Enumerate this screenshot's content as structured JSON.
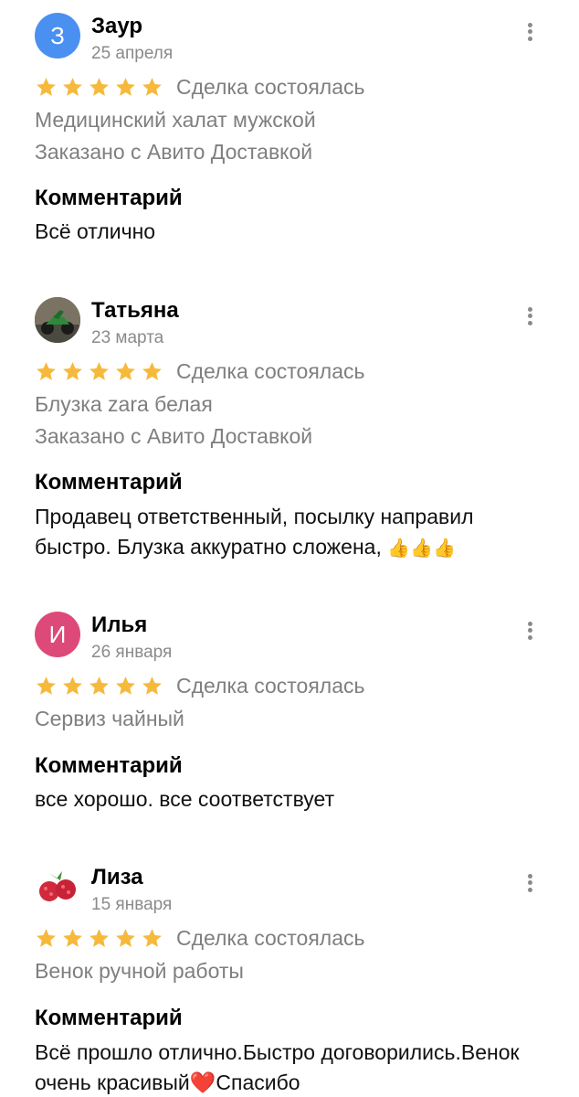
{
  "reviews": [
    {
      "author": "Заур",
      "avatar_letter": "З",
      "avatar_color": "#4a90f0",
      "date": "25 апреля",
      "deal_status": "Сделка состоялась",
      "rating": 5,
      "item": "Медицинский халат мужской",
      "delivery": "Заказано с Авито Доставкой",
      "comment_heading": "Комментарий",
      "comment": "Всё отлично"
    },
    {
      "author": "Татьяна",
      "avatar_image": "motorcycle-photo",
      "date": "23 марта",
      "deal_status": "Сделка состоялась",
      "rating": 5,
      "item": "Блузка zara белая",
      "delivery": "Заказано с Авито Доставкой",
      "comment_heading": "Комментарий",
      "comment": "Продавец ответственный, посылку направил быстро. Блузка аккуратно сложена,",
      "comment_emoji": "👍👍👍"
    },
    {
      "author": "Илья",
      "avatar_letter": "И",
      "avatar_color": "#dd4a7a",
      "date": "26 января",
      "deal_status": "Сделка состоялась",
      "rating": 5,
      "item": "Сервиз чайный",
      "comment_heading": "Комментарий",
      "comment": "все хорошо. все соответствует"
    },
    {
      "author": "Лиза",
      "avatar_image": "raspberry-photo",
      "date": "15 января",
      "deal_status": "Сделка состоялась",
      "rating": 5,
      "item": "Венок ручной работы",
      "comment_heading": "Комментарий",
      "comment": "Всё прошло отлично.Быстро договорились.Венок очень красивый",
      "comment_emoji": "❤️",
      "comment_tail": "Спасибо"
    }
  ],
  "colors": {
    "star": "#f6b93b",
    "muted": "#7f7f7f"
  },
  "icons": {
    "menu": "more-vertical-icon",
    "star": "star-icon"
  }
}
